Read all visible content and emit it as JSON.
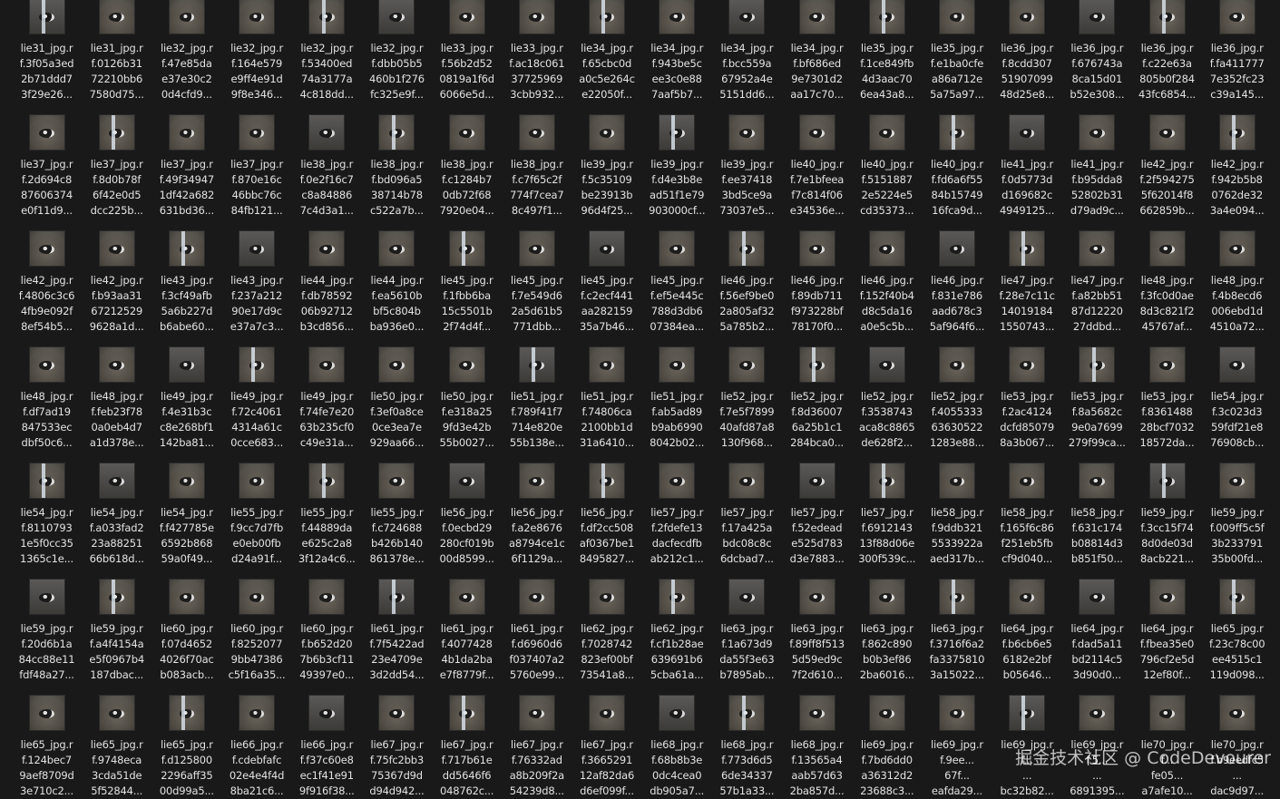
{
  "rows": [
    [
      {
        "l1": "lie31_jpg.r",
        "l2": "f.3f05a3ed",
        "l3": "2b71ddd7",
        "l4": "3f29e26..."
      },
      {
        "l1": "lie31_jpg.r",
        "l2": "f.0126b31",
        "l3": "72210bb6",
        "l4": "7580d75..."
      },
      {
        "l1": "lie32_jpg.r",
        "l2": "f.47e85da",
        "l3": "e37e30c2",
        "l4": "0d4cfd9..."
      },
      {
        "l1": "lie32_jpg.r",
        "l2": "f.164e579",
        "l3": "e9ff4e91d",
        "l4": "9f8e346..."
      },
      {
        "l1": "lie32_jpg.r",
        "l2": "f.53400ed",
        "l3": "74a3177a",
        "l4": "4c818dd..."
      },
      {
        "l1": "lie32_jpg.r",
        "l2": "f.dbb05b5",
        "l3": "460b1f276",
        "l4": "fc325e9f..."
      },
      {
        "l1": "lie33_jpg.r",
        "l2": "f.56b2d52",
        "l3": "0819a1f6d",
        "l4": "6066e5d..."
      },
      {
        "l1": "lie33_jpg.r",
        "l2": "f.ac18c061",
        "l3": "37725969",
        "l4": "3cbb932..."
      },
      {
        "l1": "lie34_jpg.r",
        "l2": "f.65cbc0d",
        "l3": "a0c5e264c",
        "l4": "e22050f..."
      },
      {
        "l1": "lie34_jpg.r",
        "l2": "f.943be5c",
        "l3": "ee3c0e88",
        "l4": "7aaf5b7..."
      },
      {
        "l1": "lie34_jpg.r",
        "l2": "f.bcc559a",
        "l3": "67952a4e",
        "l4": "5151dd6..."
      },
      {
        "l1": "lie34_jpg.r",
        "l2": "f.bf686ed",
        "l3": "9e7301d2",
        "l4": "aa17c70..."
      },
      {
        "l1": "lie35_jpg.r",
        "l2": "f.1ce849fb",
        "l3": "4d3aac70",
        "l4": "6ea43a8..."
      },
      {
        "l1": "lie35_jpg.r",
        "l2": "f.e1ba0cfe",
        "l3": "a86a712e",
        "l4": "5a75a97..."
      },
      {
        "l1": "lie36_jpg.r",
        "l2": "f.8cdd307",
        "l3": "51907099",
        "l4": "48d25e8..."
      },
      {
        "l1": "lie36_jpg.r",
        "l2": "f.676743a",
        "l3": "8ca15d01",
        "l4": "b52e308..."
      },
      {
        "l1": "lie36_jpg.r",
        "l2": "f.c22e63a",
        "l3": "805b0f284",
        "l4": "43fc6854..."
      },
      {
        "l1": "lie36_jpg.r",
        "l2": "f.fa411777",
        "l3": "7e352fc23",
        "l4": "c39a145..."
      }
    ],
    [
      {
        "l1": "lie37_jpg.r",
        "l2": "f.2d694c8",
        "l3": "87606374",
        "l4": "e0f11d9..."
      },
      {
        "l1": "lie37_jpg.r",
        "l2": "f.8d0b78f",
        "l3": "6f42e0d5",
        "l4": "dcc225b..."
      },
      {
        "l1": "lie37_jpg.r",
        "l2": "f.49f34947",
        "l3": "1df42a682",
        "l4": "631bd36..."
      },
      {
        "l1": "lie37_jpg.r",
        "l2": "f.870e16c",
        "l3": "46bbc76c",
        "l4": "84fb121..."
      },
      {
        "l1": "lie38_jpg.r",
        "l2": "f.0e2f16c7",
        "l3": "c8a84886",
        "l4": "7c4d3a1..."
      },
      {
        "l1": "lie38_jpg.r",
        "l2": "f.bd096a5",
        "l3": "38714b78",
        "l4": "c522a7b..."
      },
      {
        "l1": "lie38_jpg.r",
        "l2": "f.c1284b7",
        "l3": "0db72f68",
        "l4": "7920e04..."
      },
      {
        "l1": "lie38_jpg.r",
        "l2": "f.c7f65c2f",
        "l3": "774f7cea7",
        "l4": "8c497f1..."
      },
      {
        "l1": "lie39_jpg.r",
        "l2": "f.5c35109",
        "l3": "be23913b",
        "l4": "96d4f25..."
      },
      {
        "l1": "lie39_jpg.r",
        "l2": "f.d4e3b8e",
        "l3": "ad51f1e79",
        "l4": "903000cf..."
      },
      {
        "l1": "lie39_jpg.r",
        "l2": "f.ee37418",
        "l3": "3bd5ce9a",
        "l4": "73037e5..."
      },
      {
        "l1": "lie40_jpg.r",
        "l2": "f.7e1bfeea",
        "l3": "f7c814f06",
        "l4": "e34536e..."
      },
      {
        "l1": "lie40_jpg.r",
        "l2": "f.5151887",
        "l3": "2e5224e5",
        "l4": "cd35373..."
      },
      {
        "l1": "lie40_jpg.r",
        "l2": "f.fd6a6f55",
        "l3": "84b15749",
        "l4": "16fca9d..."
      },
      {
        "l1": "lie41_jpg.r",
        "l2": "f.0d5773d",
        "l3": "d169682c",
        "l4": "4949125..."
      },
      {
        "l1": "lie41_jpg.r",
        "l2": "f.b95dda8",
        "l3": "52802b31",
        "l4": "d79ad9c..."
      },
      {
        "l1": "lie42_jpg.r",
        "l2": "f.2f594275",
        "l3": "5f62014f8",
        "l4": "662859b..."
      },
      {
        "l1": "lie42_jpg.r",
        "l2": "f.942b5b8",
        "l3": "0762de32",
        "l4": "3a4e094..."
      }
    ],
    [
      {
        "l1": "lie42_jpg.r",
        "l2": "f.4806c3c6",
        "l3": "4fb9e092f",
        "l4": "8ef54b5..."
      },
      {
        "l1": "lie42_jpg.r",
        "l2": "f.b93aa31",
        "l3": "67212529",
        "l4": "9628a1d..."
      },
      {
        "l1": "lie43_jpg.r",
        "l2": "f.3cf49afb",
        "l3": "5a6b227d",
        "l4": "b6abe60..."
      },
      {
        "l1": "lie43_jpg.r",
        "l2": "f.237a212",
        "l3": "90e17d9c",
        "l4": "e37a7c3..."
      },
      {
        "l1": "lie44_jpg.r",
        "l2": "f.db78592",
        "l3": "06b92712",
        "l4": "b3cd856..."
      },
      {
        "l1": "lie44_jpg.r",
        "l2": "f.ea5610b",
        "l3": "bf5c804b",
        "l4": "ba936e0..."
      },
      {
        "l1": "lie45_jpg.r",
        "l2": "f.1fbb6ba",
        "l3": "15c5501b",
        "l4": "2f74d4f..."
      },
      {
        "l1": "lie45_jpg.r",
        "l2": "f.7e549d6",
        "l3": "2a5d61b5",
        "l4": "771dbb..."
      },
      {
        "l1": "lie45_jpg.r",
        "l2": "f.c2ecf441",
        "l3": "aa282159",
        "l4": "35a7b46..."
      },
      {
        "l1": "lie45_jpg.r",
        "l2": "f.ef5e445c",
        "l3": "788d3db6",
        "l4": "07384ea..."
      },
      {
        "l1": "lie46_jpg.r",
        "l2": "f.56ef9be0",
        "l3": "2a805af32",
        "l4": "5a785b2..."
      },
      {
        "l1": "lie46_jpg.r",
        "l2": "f.89db711",
        "l3": "f973228bf",
        "l4": "78170f0..."
      },
      {
        "l1": "lie46_jpg.r",
        "l2": "f.152f40b4",
        "l3": "d8c5da16",
        "l4": "a0e5c5b..."
      },
      {
        "l1": "lie46_jpg.r",
        "l2": "f.831e786",
        "l3": "aad678c3",
        "l4": "5af964f6..."
      },
      {
        "l1": "lie47_jpg.r",
        "l2": "f.28e7c11c",
        "l3": "14019184",
        "l4": "1550743..."
      },
      {
        "l1": "lie47_jpg.r",
        "l2": "f.a82bb51",
        "l3": "87d12220",
        "l4": "27ddbd..."
      },
      {
        "l1": "lie48_jpg.r",
        "l2": "f.3fc0d0ae",
        "l3": "8d3c821f2",
        "l4": "45767af..."
      },
      {
        "l1": "lie48_jpg.r",
        "l2": "f.4b8ecd6",
        "l3": "006ebd1d",
        "l4": "4510a72..."
      }
    ],
    [
      {
        "l1": "lie48_jpg.r",
        "l2": "f.df7ad19",
        "l3": "847533ec",
        "l4": "dbf50c6..."
      },
      {
        "l1": "lie48_jpg.r",
        "l2": "f.feb23f78",
        "l3": "0a0eb4d7",
        "l4": "a1d378e..."
      },
      {
        "l1": "lie49_jpg.r",
        "l2": "f.4e31b3c",
        "l3": "c8e268bf1",
        "l4": "142ba81..."
      },
      {
        "l1": "lie49_jpg.r",
        "l2": "f.72c4061",
        "l3": "4314a61c",
        "l4": "0cce683..."
      },
      {
        "l1": "lie49_jpg.r",
        "l2": "f.74fe7e20",
        "l3": "63b235cf0",
        "l4": "c49e31a..."
      },
      {
        "l1": "lie50_jpg.r",
        "l2": "f.3ef0a8ce",
        "l3": "0ce3ea7e",
        "l4": "929aa66..."
      },
      {
        "l1": "lie50_jpg.r",
        "l2": "f.e318a25",
        "l3": "9fd3e42b",
        "l4": "55b0027..."
      },
      {
        "l1": "lie51_jpg.r",
        "l2": "f.789f41f7",
        "l3": "714e820e",
        "l4": "55b138e..."
      },
      {
        "l1": "lie51_jpg.r",
        "l2": "f.74806ca",
        "l3": "2100bb1d",
        "l4": "31a6410..."
      },
      {
        "l1": "lie51_jpg.r",
        "l2": "f.ab5ad89",
        "l3": "b9ab6990",
        "l4": "8042b02..."
      },
      {
        "l1": "lie52_jpg.r",
        "l2": "f.7e5f7899",
        "l3": "40afd87a8",
        "l4": "130f968..."
      },
      {
        "l1": "lie52_jpg.r",
        "l2": "f.8d36007",
        "l3": "6a25b1c1",
        "l4": "284bca0..."
      },
      {
        "l1": "lie52_jpg.r",
        "l2": "f.3538743",
        "l3": "aca8c8865",
        "l4": "de628f2..."
      },
      {
        "l1": "lie52_jpg.r",
        "l2": "f.4055333",
        "l3": "63630522",
        "l4": "1283e88..."
      },
      {
        "l1": "lie53_jpg.r",
        "l2": "f.2ac4124",
        "l3": "dcfd85079",
        "l4": "8a3b067..."
      },
      {
        "l1": "lie53_jpg.r",
        "l2": "f.8a5682c",
        "l3": "9e0a7699",
        "l4": "279f99ca..."
      },
      {
        "l1": "lie53_jpg.r",
        "l2": "f.8361488",
        "l3": "28bcf7032",
        "l4": "18572da..."
      },
      {
        "l1": "lie54_jpg.r",
        "l2": "f.3c023d3",
        "l3": "59fdf21e8",
        "l4": "76908cb..."
      }
    ],
    [
      {
        "l1": "lie54_jpg.r",
        "l2": "f.8110793",
        "l3": "1e5f0cc35",
        "l4": "1365c1e..."
      },
      {
        "l1": "lie54_jpg.r",
        "l2": "f.a033fad2",
        "l3": "23a88251",
        "l4": "66b618d..."
      },
      {
        "l1": "lie54_jpg.r",
        "l2": "f.f427785e",
        "l3": "6592b868",
        "l4": "59a0f49..."
      },
      {
        "l1": "lie55_jpg.r",
        "l2": "f.9cc7d7fb",
        "l3": "e0eb00fb",
        "l4": "d24a91f..."
      },
      {
        "l1": "lie55_jpg.r",
        "l2": "f.44889da",
        "l3": "e625c2a8",
        "l4": "3f12a4c6..."
      },
      {
        "l1": "lie55_jpg.r",
        "l2": "f.c724688",
        "l3": "b426b140",
        "l4": "861378e..."
      },
      {
        "l1": "lie56_jpg.r",
        "l2": "f.0ecbd29",
        "l3": "280cf019b",
        "l4": "00d8599..."
      },
      {
        "l1": "lie56_jpg.r",
        "l2": "f.a2e8676",
        "l3": "a8794ce1c",
        "l4": "6f1129a..."
      },
      {
        "l1": "lie56_jpg.r",
        "l2": "f.df2cc508",
        "l3": "af0367be1",
        "l4": "8495827..."
      },
      {
        "l1": "lie57_jpg.r",
        "l2": "f.2fdefe13",
        "l3": "dacfecdfb",
        "l4": "ab212c1..."
      },
      {
        "l1": "lie57_jpg.r",
        "l2": "f.17a425a",
        "l3": "bdc08c8c",
        "l4": "6dcbad7..."
      },
      {
        "l1": "lie57_jpg.r",
        "l2": "f.52edead",
        "l3": "e525d783",
        "l4": "d3e7883..."
      },
      {
        "l1": "lie57_jpg.r",
        "l2": "f.6912143",
        "l3": "13f88d06e",
        "l4": "300f539c..."
      },
      {
        "l1": "lie58_jpg.r",
        "l2": "f.9ddb321",
        "l3": "5533922a",
        "l4": "aed317b..."
      },
      {
        "l1": "lie58_jpg.r",
        "l2": "f.165f6c86",
        "l3": "f251eb5fb",
        "l4": "cf9d040..."
      },
      {
        "l1": "lie58_jpg.r",
        "l2": "f.631c174",
        "l3": "b08814d3",
        "l4": "b851f50..."
      },
      {
        "l1": "lie59_jpg.r",
        "l2": "f.3cc15f74",
        "l3": "8d0de03d",
        "l4": "8acb221..."
      },
      {
        "l1": "lie59_jpg.r",
        "l2": "f.009ff5c5f",
        "l3": "3b233791",
        "l4": "35b00fd..."
      }
    ],
    [
      {
        "l1": "lie59_jpg.r",
        "l2": "f.20d6b1a",
        "l3": "84cc88e11",
        "l4": "fdf48a27..."
      },
      {
        "l1": "lie59_jpg.r",
        "l2": "f.a4f4154a",
        "l3": "e5f0967b4",
        "l4": "187dbac..."
      },
      {
        "l1": "lie60_jpg.r",
        "l2": "f.07d4652",
        "l3": "4026f70ac",
        "l4": "b083acb..."
      },
      {
        "l1": "lie60_jpg.r",
        "l2": "f.8252077",
        "l3": "9bb47386",
        "l4": "c5f16a35..."
      },
      {
        "l1": "lie60_jpg.r",
        "l2": "f.b652d20",
        "l3": "7b6b3cf11",
        "l4": "49397e0..."
      },
      {
        "l1": "lie61_jpg.r",
        "l2": "f.7f5422ad",
        "l3": "23e4709e",
        "l4": "3d2dd54..."
      },
      {
        "l1": "lie61_jpg.r",
        "l2": "f.4077428",
        "l3": "4b1da2ba",
        "l4": "e7f8779f..."
      },
      {
        "l1": "lie61_jpg.r",
        "l2": "f.d6960d6",
        "l3": "f037407a2",
        "l4": "5760e99..."
      },
      {
        "l1": "lie62_jpg.r",
        "l2": "f.7028742",
        "l3": "823ef00bf",
        "l4": "73541a8..."
      },
      {
        "l1": "lie62_jpg.r",
        "l2": "f.cf1b28ae",
        "l3": "639691b6",
        "l4": "5cba61a..."
      },
      {
        "l1": "lie63_jpg.r",
        "l2": "f.1a673d9",
        "l3": "da55f3e63",
        "l4": "b7895ab..."
      },
      {
        "l1": "lie63_jpg.r",
        "l2": "f.89ff8f513",
        "l3": "5d59ed9c",
        "l4": "7f2d610..."
      },
      {
        "l1": "lie63_jpg.r",
        "l2": "f.862c890",
        "l3": "b0b3ef86",
        "l4": "2ba6016..."
      },
      {
        "l1": "lie63_jpg.r",
        "l2": "f.3716f6a2",
        "l3": "fa3375810",
        "l4": "3a15022..."
      },
      {
        "l1": "lie64_jpg.r",
        "l2": "f.b6cb6e5",
        "l3": "6182e2bf",
        "l4": "b05646..."
      },
      {
        "l1": "lie64_jpg.r",
        "l2": "f.dad5a11",
        "l3": "bd2114c5",
        "l4": "3d90d0..."
      },
      {
        "l1": "lie64_jpg.r",
        "l2": "f.fbea35e0",
        "l3": "796cf2e5d",
        "l4": "12ef80f..."
      },
      {
        "l1": "lie65_jpg.r",
        "l2": "f.23c78c00",
        "l3": "ee4515c1",
        "l4": "119d098..."
      }
    ],
    [
      {
        "l1": "lie65_jpg.r",
        "l2": "f.124bec7",
        "l3": "9aef8709d",
        "l4": "3e710c2..."
      },
      {
        "l1": "lie65_jpg.r",
        "l2": "f.9748eca",
        "l3": "3cda51de",
        "l4": "5f52844..."
      },
      {
        "l1": "lie65_jpg.r",
        "l2": "f.d125800",
        "l3": "2296aff35",
        "l4": "00d99a5..."
      },
      {
        "l1": "lie66_jpg.r",
        "l2": "f.cdebfafc",
        "l3": "02e4e4f4d",
        "l4": "8ba21c6..."
      },
      {
        "l1": "lie66_jpg.r",
        "l2": "f.f37c60e8",
        "l3": "ec1f41e91",
        "l4": "9f916f38..."
      },
      {
        "l1": "lie67_jpg.r",
        "l2": "f.75fc2bb3",
        "l3": "75367d9d",
        "l4": "d94d942..."
      },
      {
        "l1": "lie67_jpg.r",
        "l2": "f.717b61e",
        "l3": "dd5646f6",
        "l4": "048762c..."
      },
      {
        "l1": "lie67_jpg.r",
        "l2": "f.76332ad",
        "l3": "a8b209f2a",
        "l4": "54239d8..."
      },
      {
        "l1": "lie67_jpg.r",
        "l2": "f.3665291",
        "l3": "12af82da6",
        "l4": "d6ef099f..."
      },
      {
        "l1": "lie68_jpg.r",
        "l2": "f.68b8b3e",
        "l3": "0dc4cea0",
        "l4": "db905a7..."
      },
      {
        "l1": "lie68_jpg.r",
        "l2": "f.773d6d5",
        "l3": "6de34337",
        "l4": "57b1a33..."
      },
      {
        "l1": "lie68_jpg.r",
        "l2": "f.13565a4",
        "l3": "aab57d63",
        "l4": "2ba857d..."
      },
      {
        "l1": "lie69_jpg.r",
        "l2": "f.7bd6dd0",
        "l3": "a36312d2",
        "l4": "23688c3..."
      },
      {
        "l1": "lie69_jpg.r",
        "l2": "f.9ee...",
        "l3": "67f...",
        "l4": "eafda29..."
      },
      {
        "l1": "lie69_jpg.r",
        "l2": "f...",
        "l3": "...",
        "l4": "bc32b82..."
      },
      {
        "l1": "lie69_jpg.r",
        "l2": "f.5...",
        "l3": "...",
        "l4": "6891395..."
      },
      {
        "l1": "lie70_jpg.r",
        "l2": "f...",
        "l3": "fe05...",
        "l4": "a7afe10..."
      },
      {
        "l1": "lie70_jpg.r",
        "l2": "f.b9eedfc5",
        "l3": "...",
        "l4": "dac9d97..."
      }
    ]
  ],
  "watermark": "掘金技术社区 @ CodeDevourer"
}
